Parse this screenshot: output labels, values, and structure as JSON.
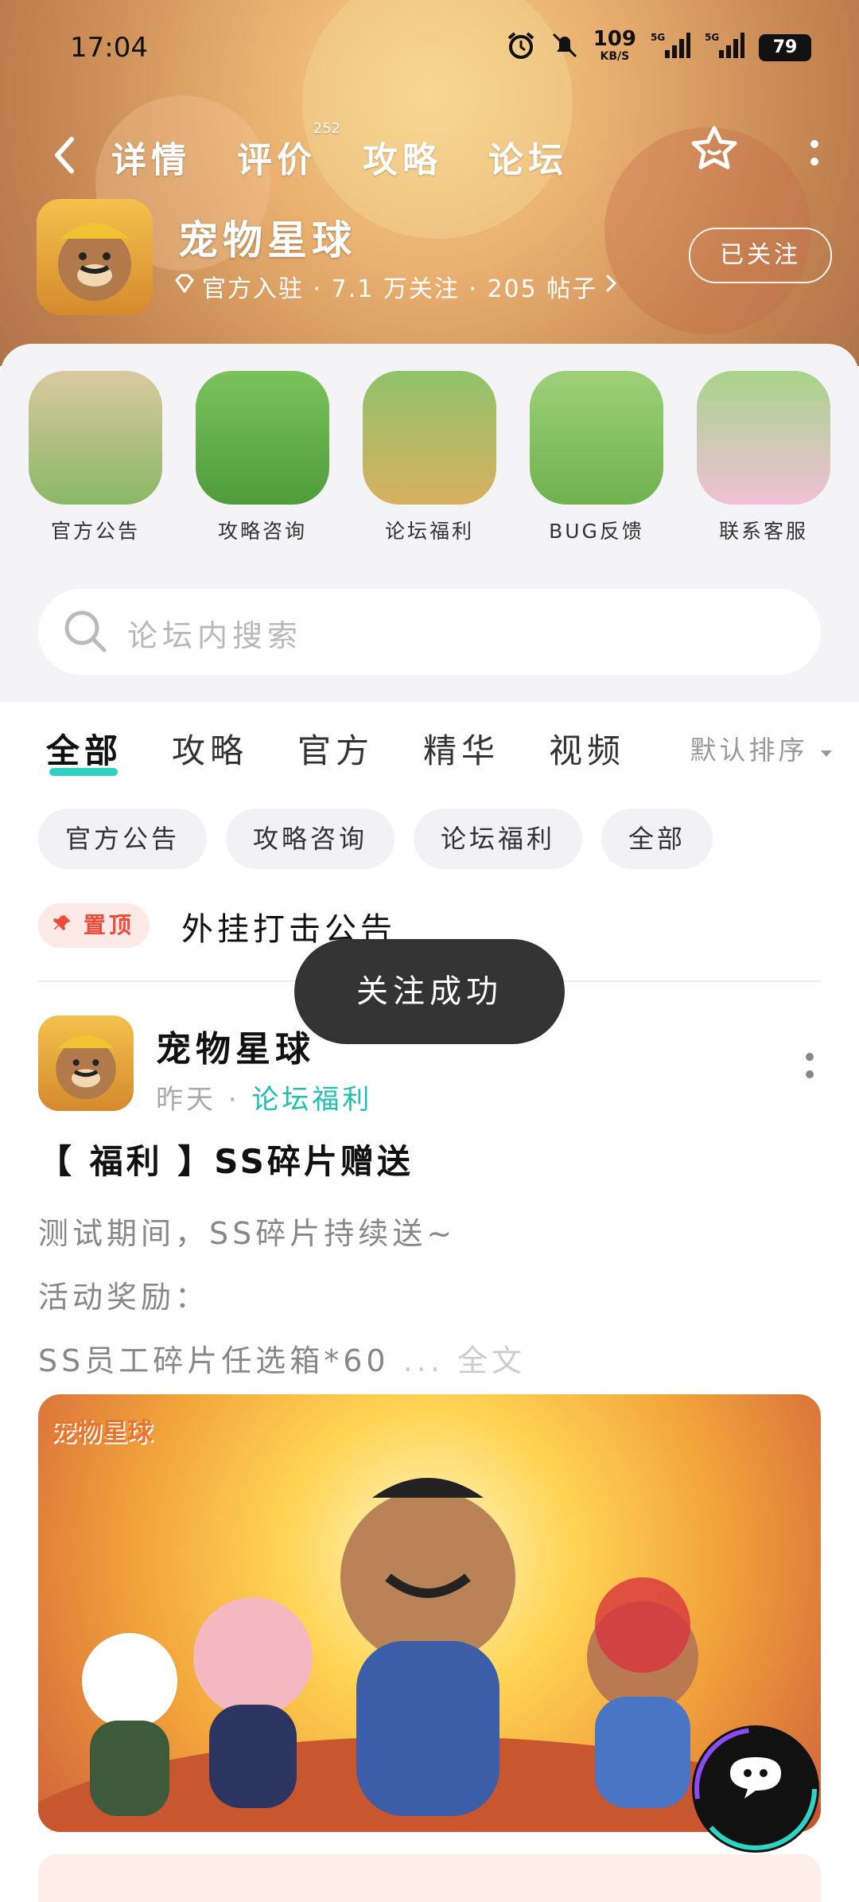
{
  "status_bar": {
    "time": "17:04",
    "net_speed": "109",
    "net_unit": "KB/S",
    "battery": "79"
  },
  "nav": {
    "tabs": [
      {
        "label": "详情"
      },
      {
        "label": "评价",
        "badge": "252"
      },
      {
        "label": "攻略"
      },
      {
        "label": "论坛"
      }
    ]
  },
  "app": {
    "name": "宠物星球",
    "meta": "官方入驻 · 7.1 万关注 · 205 帖子",
    "follow_label": "已关注"
  },
  "shortcuts": [
    {
      "label": "官方公告"
    },
    {
      "label": "攻略咨询"
    },
    {
      "label": "论坛福利"
    },
    {
      "label": "BUG反馈"
    },
    {
      "label": "联系客服"
    }
  ],
  "search": {
    "placeholder": "论坛内搜索"
  },
  "filter_tabs": [
    {
      "label": "全部"
    },
    {
      "label": "攻略"
    },
    {
      "label": "官方"
    },
    {
      "label": "精华"
    },
    {
      "label": "视频"
    }
  ],
  "sort_label": "默认排序",
  "chips": [
    {
      "label": "官方公告"
    },
    {
      "label": "攻略咨询"
    },
    {
      "label": "论坛福利"
    },
    {
      "label": "全部"
    }
  ],
  "pinned": {
    "tag": "置顶",
    "title": "外挂打击公告"
  },
  "toast": "关注成功",
  "post": {
    "author": "宠物星球",
    "time": "昨天",
    "category": "论坛福利",
    "title": "【 福利 】SS碎片赠送",
    "lines": [
      "测试期间，SS碎片持续送~",
      "活动奖励：",
      "SS员工碎片任选箱*60"
    ],
    "full_text": "全文",
    "banner_logo": "宠物星球"
  },
  "colors": {
    "accent": "#2dd3c4",
    "pin_red": "#f04a3a"
  }
}
